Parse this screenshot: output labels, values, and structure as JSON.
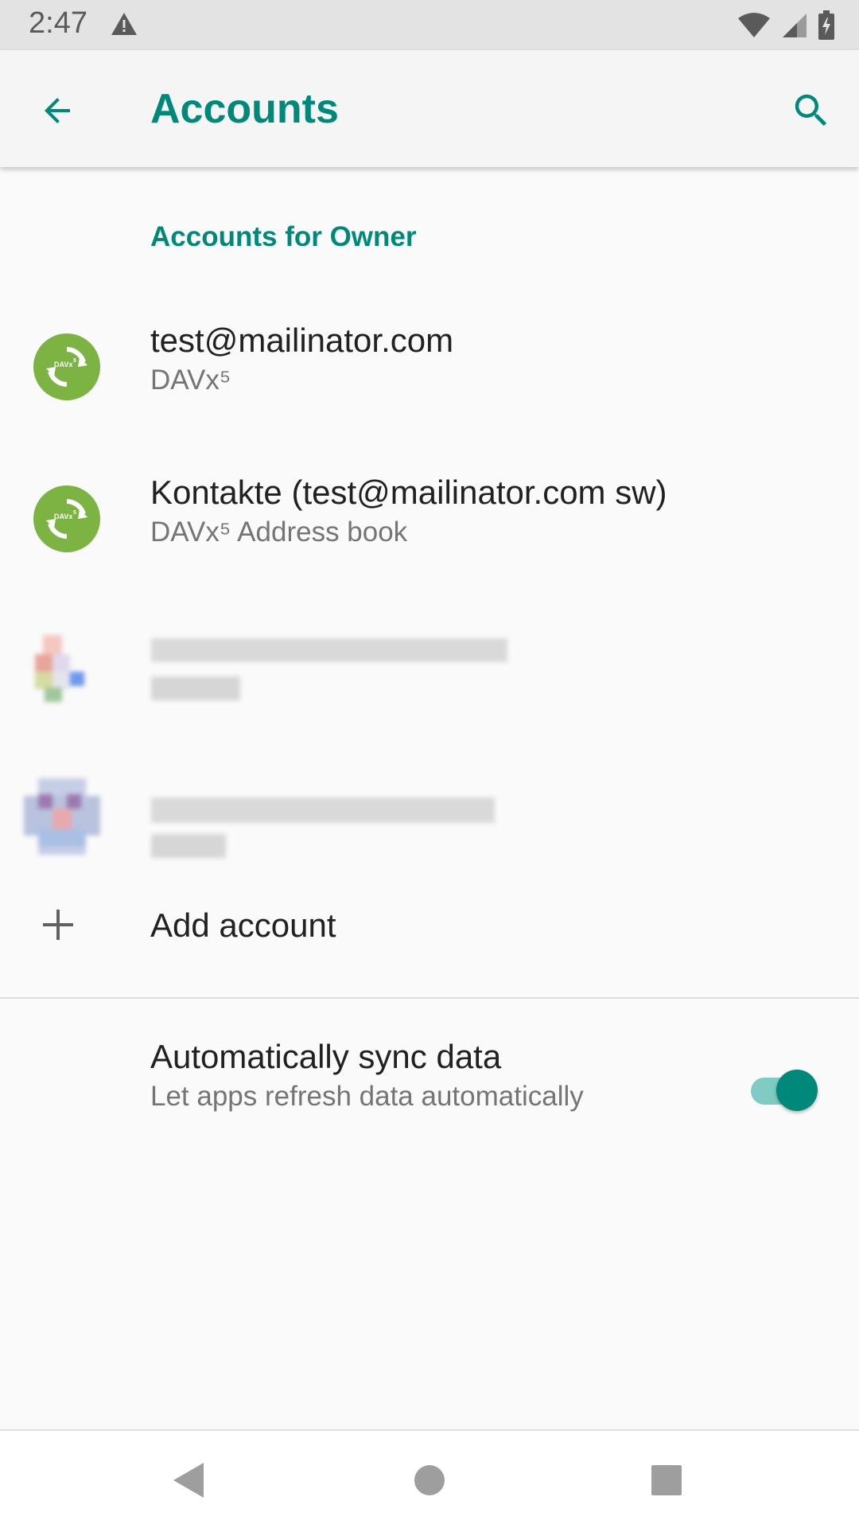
{
  "status_bar": {
    "time": "2:47",
    "icons": [
      "warning-icon",
      "wifi-icon",
      "signal-icon",
      "battery-icon"
    ]
  },
  "app_bar": {
    "title": "Accounts",
    "back_icon": "arrow-back-icon",
    "search_icon": "search-icon"
  },
  "section": {
    "header": "Accounts for Owner"
  },
  "accounts": [
    {
      "title": "test@mailinator.com",
      "subtitle": "DAVx⁵",
      "icon": "davx5-sync-icon",
      "blurred": false
    },
    {
      "title": "Kontakte (test@mailinator.com sw)",
      "subtitle": "DAVx⁵ Address book",
      "icon": "davx5-sync-icon",
      "blurred": false
    },
    {
      "icon": "google-account-icon",
      "blurred": true
    },
    {
      "icon": "account-avatar-icon",
      "blurred": true
    }
  ],
  "add_account": {
    "label": "Add account",
    "icon": "plus-icon"
  },
  "auto_sync": {
    "title": "Automatically sync data",
    "subtitle": "Let apps refresh data automatically",
    "enabled": true
  },
  "colors": {
    "accent": "#00897b",
    "davx_green": "#7cb342",
    "toggle_track": "#80cbc4"
  },
  "nav_bar": {
    "icons": [
      "back-triangle-icon",
      "home-circle-icon",
      "recents-square-icon"
    ]
  }
}
